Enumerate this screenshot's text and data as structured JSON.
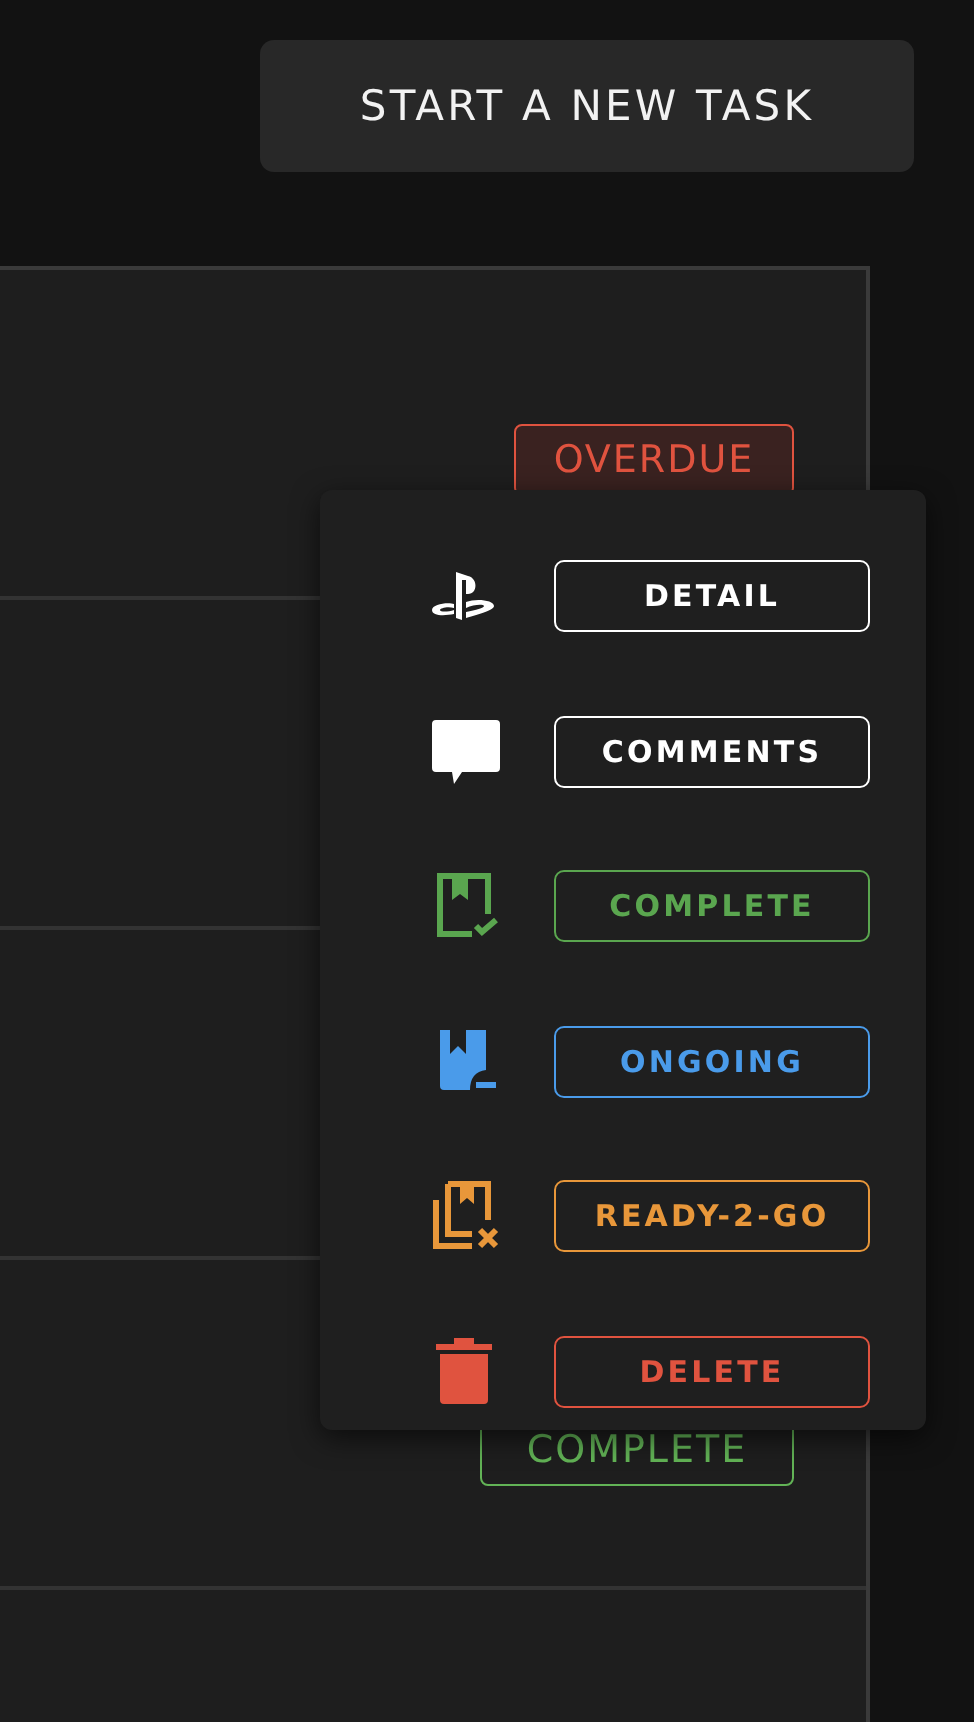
{
  "new_task_button": {
    "label": "START A NEW TASK"
  },
  "task_rows": [
    {
      "status": {
        "label": "OVERDUE",
        "kind": "overdue"
      }
    },
    {
      "status": null
    },
    {
      "status": null
    },
    {
      "status": {
        "label": "COMPLETE",
        "kind": "complete"
      }
    },
    {
      "status": null
    }
  ],
  "action_menu": {
    "items": [
      {
        "kind": "detail",
        "label": "DETAIL",
        "color": "#ffffff"
      },
      {
        "kind": "comments",
        "label": "COMMENTS",
        "color": "#ffffff"
      },
      {
        "kind": "complete",
        "label": "COMPLETE",
        "color": "#5aa64f"
      },
      {
        "kind": "ongoing",
        "label": "ONGOING",
        "color": "#4a9bea"
      },
      {
        "kind": "ready",
        "label": "READY-2-GO",
        "color": "#e8973a"
      },
      {
        "kind": "delete",
        "label": "DELETE",
        "color": "#e0533f"
      }
    ]
  }
}
